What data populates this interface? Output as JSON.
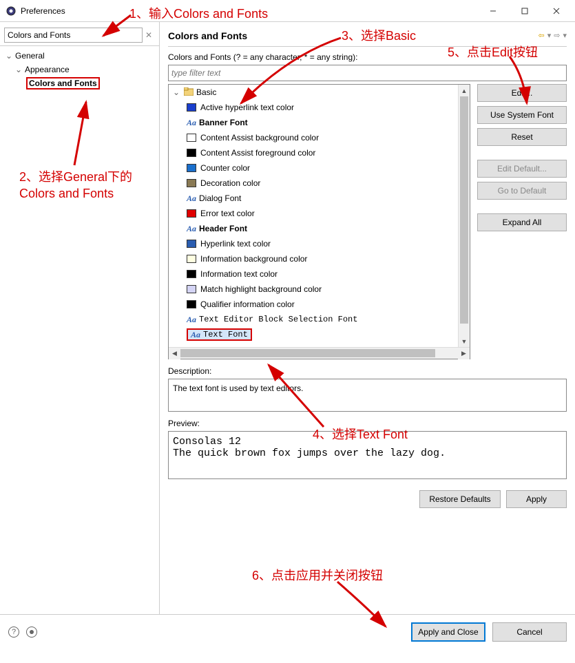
{
  "window": {
    "title": "Preferences"
  },
  "sidebar": {
    "search_value": "Colors and Fonts",
    "items": [
      {
        "label": "General"
      },
      {
        "label": "Appearance"
      },
      {
        "label": "Colors and Fonts"
      }
    ]
  },
  "main": {
    "title": "Colors and Fonts",
    "hint": "Colors and Fonts (? = any character, * = any string):",
    "filter_placeholder": "type filter text",
    "tree": {
      "root": "Basic",
      "items": [
        {
          "label": "Active hyperlink text color",
          "swatch": "#1a3fcc",
          "type": "color"
        },
        {
          "label": "Banner Font",
          "type": "font",
          "bold": true
        },
        {
          "label": "Content Assist background color",
          "swatch": "#ffffff",
          "type": "color"
        },
        {
          "label": "Content Assist foreground color",
          "swatch": "#000000",
          "type": "color"
        },
        {
          "label": "Counter color",
          "swatch": "#1a6fcc",
          "type": "color"
        },
        {
          "label": "Decoration color",
          "swatch": "#8a7a55",
          "type": "color"
        },
        {
          "label": "Dialog Font",
          "type": "font"
        },
        {
          "label": "Error text color",
          "swatch": "#e00000",
          "type": "color"
        },
        {
          "label": "Header Font",
          "type": "font",
          "bold": true
        },
        {
          "label": "Hyperlink text color",
          "swatch": "#2a5db0",
          "type": "color"
        },
        {
          "label": "Information background color",
          "swatch": "#ffffe1",
          "type": "color"
        },
        {
          "label": "Information text color",
          "swatch": "#000000",
          "type": "color"
        },
        {
          "label": "Match highlight background color",
          "swatch": "#d4d4f5",
          "type": "color"
        },
        {
          "label": "Qualifier information color",
          "swatch": "#000000",
          "type": "color"
        },
        {
          "label": "Text Editor Block Selection Font",
          "type": "font",
          "mono": true
        },
        {
          "label": "Text Font",
          "type": "font",
          "mono": true,
          "selected": true
        }
      ]
    },
    "buttons": {
      "edit": "Edit...",
      "use_system": "Use System Font",
      "reset": "Reset",
      "edit_default": "Edit Default...",
      "go_default": "Go to Default",
      "expand_all": "Expand All"
    },
    "description_label": "Description:",
    "description_text": "The text font is used by text editors.",
    "preview_label": "Preview:",
    "preview_text": "Consolas 12\nThe quick brown fox jumps over the lazy dog.",
    "restore_defaults": "Restore Defaults",
    "apply": "Apply"
  },
  "dialog": {
    "apply_close": "Apply and Close",
    "cancel": "Cancel"
  },
  "annotations": {
    "a1": "1、输入Colors and Fonts",
    "a2": "2、选择General下的\nColors and Fonts",
    "a3": "3、选择Basic",
    "a4": "4、选择Text  Font",
    "a5": "5、点击Edit按钮",
    "a6": "6、点击应用并关闭按钮"
  }
}
